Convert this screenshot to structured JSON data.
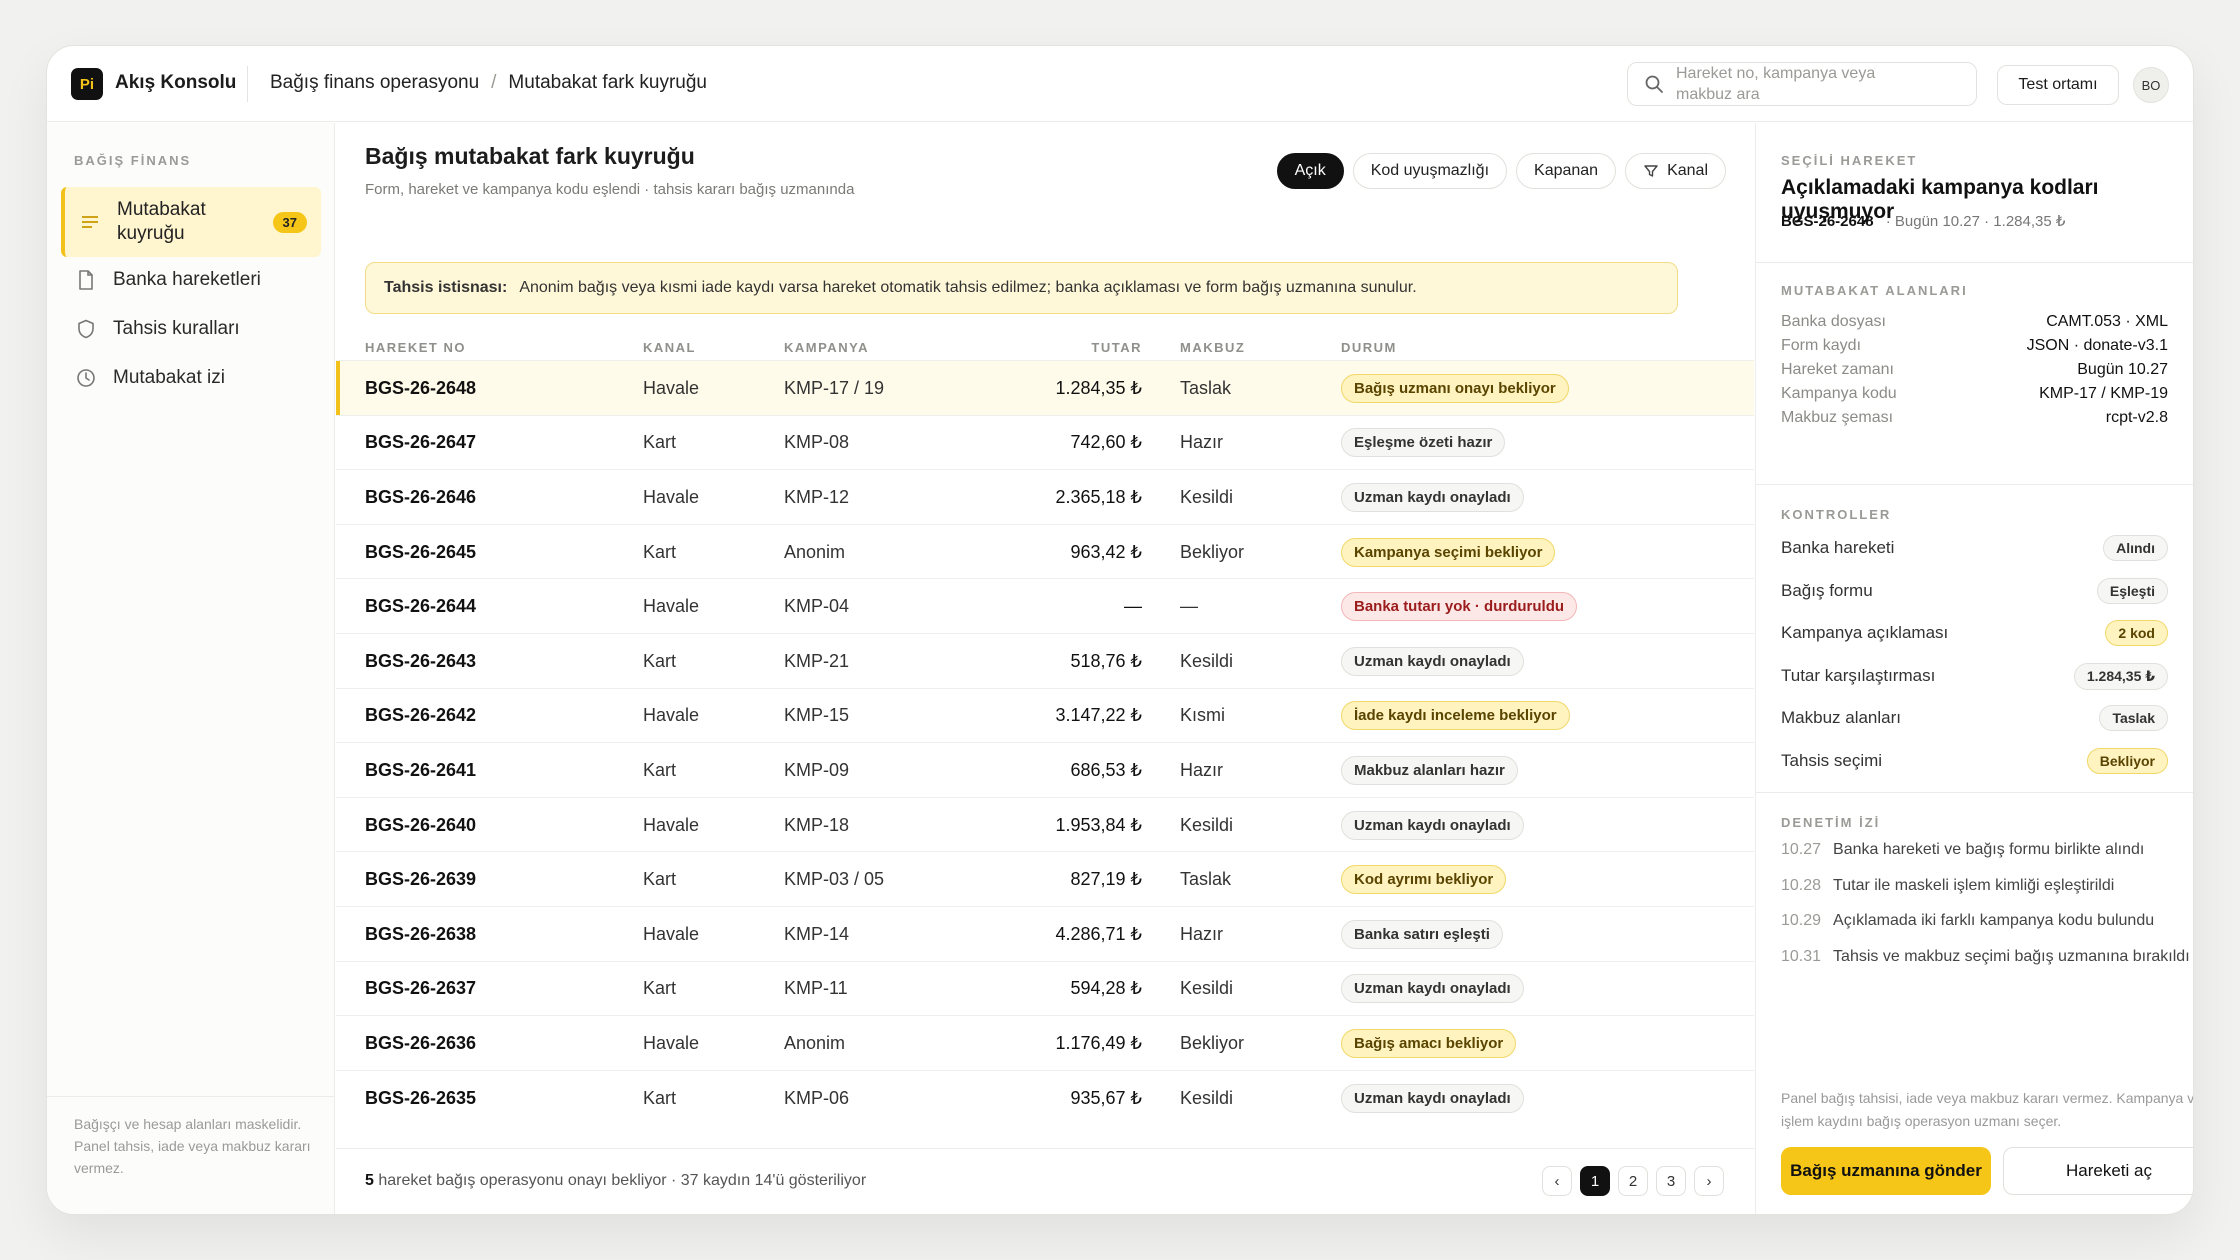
{
  "app": {
    "logo": "Pi",
    "title": "Akış Konsolu"
  },
  "breadcrumb": [
    "Bağış finans operasyonu",
    "Mutabakat fark kuyruğu"
  ],
  "search": {
    "placeholder": "Hareket no, kampanya veya makbuz ara"
  },
  "header": {
    "env_label": "Test ortamı",
    "avatar": "BO"
  },
  "sidebar": {
    "heading": "BAĞIŞ FİNANS",
    "items": [
      {
        "label": "Mutabakat kuyruğu",
        "icon": "list-icon",
        "count": "37"
      },
      {
        "label": "Banka hareketleri",
        "icon": "document-icon"
      },
      {
        "label": "Tahsis kuralları",
        "icon": "shield-icon"
      },
      {
        "label": "Mutabakat izi",
        "icon": "clock-icon"
      }
    ],
    "footer": "Bağışçı ve hesap alanları maskelidir. Panel tahsis, iade veya makbuz kararı vermez."
  },
  "main": {
    "title": "Bağış mutabakat fark kuyruğu",
    "subtitle": "Form, hareket ve kampanya kodu eşlendi · tahsis kararı bağış uzmanında",
    "filters": [
      "Açık",
      "Kod uyuşmazlığı",
      "Kapanan",
      "Kanal"
    ],
    "notice": {
      "label": "Tahsis istisnası:",
      "text": "Anonim bağış veya kısmi iade kaydı varsa hareket otomatik tahsis edilmez; banka açıklaması ve form bağış uzmanına sunulur."
    },
    "columns": [
      "HAREKET NO",
      "KANAL",
      "KAMPANYA",
      "TUTAR",
      "MAKBUZ",
      "DURUM"
    ],
    "rows": [
      {
        "no": "BGS-26-2648",
        "kanal": "Havale",
        "kampanya": "KMP-17 / 19",
        "tutar": "1.284,35 ₺",
        "makbuz": "Taslak",
        "durum": "Bağış uzmanı onayı bekliyor",
        "status": "warn"
      },
      {
        "no": "BGS-26-2647",
        "kanal": "Kart",
        "kampanya": "KMP-08",
        "tutar": "742,60 ₺",
        "makbuz": "Hazır",
        "durum": "Eşleşme özeti hazır",
        "status": "neutral"
      },
      {
        "no": "BGS-26-2646",
        "kanal": "Havale",
        "kampanya": "KMP-12",
        "tutar": "2.365,18 ₺",
        "makbuz": "Kesildi",
        "durum": "Uzman kaydı onayladı",
        "status": "neutral"
      },
      {
        "no": "BGS-26-2645",
        "kanal": "Kart",
        "kampanya": "Anonim",
        "tutar": "963,42 ₺",
        "makbuz": "Bekliyor",
        "durum": "Kampanya seçimi bekliyor",
        "status": "warn"
      },
      {
        "no": "BGS-26-2644",
        "kanal": "Havale",
        "kampanya": "KMP-04",
        "tutar": "—",
        "makbuz": "—",
        "durum": "Banka tutarı yok · durduruldu",
        "status": "err"
      },
      {
        "no": "BGS-26-2643",
        "kanal": "Kart",
        "kampanya": "KMP-21",
        "tutar": "518,76 ₺",
        "makbuz": "Kesildi",
        "durum": "Uzman kaydı onayladı",
        "status": "neutral"
      },
      {
        "no": "BGS-26-2642",
        "kanal": "Havale",
        "kampanya": "KMP-15",
        "tutar": "3.147,22 ₺",
        "makbuz": "Kısmi",
        "durum": "İade kaydı inceleme bekliyor",
        "status": "warn"
      },
      {
        "no": "BGS-26-2641",
        "kanal": "Kart",
        "kampanya": "KMP-09",
        "tutar": "686,53 ₺",
        "makbuz": "Hazır",
        "durum": "Makbuz alanları hazır",
        "status": "neutral"
      },
      {
        "no": "BGS-26-2640",
        "kanal": "Havale",
        "kampanya": "KMP-18",
        "tutar": "1.953,84 ₺",
        "makbuz": "Kesildi",
        "durum": "Uzman kaydı onayladı",
        "status": "neutral"
      },
      {
        "no": "BGS-26-2639",
        "kanal": "Kart",
        "kampanya": "KMP-03 / 05",
        "tutar": "827,19 ₺",
        "makbuz": "Taslak",
        "durum": "Kod ayrımı bekliyor",
        "status": "warn"
      },
      {
        "no": "BGS-26-2638",
        "kanal": "Havale",
        "kampanya": "KMP-14",
        "tutar": "4.286,71 ₺",
        "makbuz": "Hazır",
        "durum": "Banka satırı eşleşti",
        "status": "neutral"
      },
      {
        "no": "BGS-26-2637",
        "kanal": "Kart",
        "kampanya": "KMP-11",
        "tutar": "594,28 ₺",
        "makbuz": "Kesildi",
        "durum": "Uzman kaydı onayladı",
        "status": "neutral"
      },
      {
        "no": "BGS-26-2636",
        "kanal": "Havale",
        "kampanya": "Anonim",
        "tutar": "1.176,49 ₺",
        "makbuz": "Bekliyor",
        "durum": "Bağış amacı bekliyor",
        "status": "warn"
      },
      {
        "no": "BGS-26-2635",
        "kanal": "Kart",
        "kampanya": "KMP-06",
        "tutar": "935,67 ₺",
        "makbuz": "Kesildi",
        "durum": "Uzman kaydı onayladı",
        "status": "neutral"
      }
    ],
    "footer": {
      "count": "5",
      "text": "hareket bağış operasyonu onayı bekliyor · 37 kaydın 14'ü gösteriliyor"
    },
    "pager": [
      "‹",
      "1",
      "2",
      "3",
      "›"
    ]
  },
  "panel": {
    "heading": "SEÇİLİ HAREKET",
    "title": "Açıklamadaki kampanya kodları uyuşmuyor",
    "meta_id": "BGS-26-2648",
    "meta_text": "· Bugün 10.27 · 1.284,35 ₺",
    "fields_heading": "MUTABAKAT ALANLARI",
    "fields": [
      {
        "k": "Banka dosyası",
        "v": "CAMT.053 · XML"
      },
      {
        "k": "Form kaydı",
        "v": "JSON · donate-v3.1"
      },
      {
        "k": "Hareket zamanı",
        "v": "Bugün 10.27"
      },
      {
        "k": "Kampanya kodu",
        "v": "KMP-17 / KMP-19"
      },
      {
        "k": "Makbuz şeması",
        "v": "rcpt-v2.8"
      }
    ],
    "checks_heading": "KONTROLLER",
    "checks": [
      {
        "k": "Banka hareketi",
        "v": "Alındı",
        "status": "neutral"
      },
      {
        "k": "Bağış formu",
        "v": "Eşleşti",
        "status": "neutral"
      },
      {
        "k": "Kampanya açıklaması",
        "v": "2 kod",
        "status": "warn"
      },
      {
        "k": "Tutar karşılaştırması",
        "v": "1.284,35 ₺",
        "status": "neutral"
      },
      {
        "k": "Makbuz alanları",
        "v": "Taslak",
        "status": "neutral"
      },
      {
        "k": "Tahsis seçimi",
        "v": "Bekliyor",
        "status": "warn"
      }
    ],
    "audit_heading": "DENETİM İZİ",
    "audit": [
      {
        "t": "10.27",
        "text": "Banka hareketi ve bağış formu birlikte alındı"
      },
      {
        "t": "10.28",
        "text": "Tutar ile maskeli işlem kimliği eşleştirildi"
      },
      {
        "t": "10.29",
        "text": "Açıklamada iki farklı kampanya kodu bulundu"
      },
      {
        "t": "10.31",
        "text": "Tahsis ve makbuz seçimi bağış uzmanına bırakıldı"
      }
    ],
    "note": "Panel bağış tahsisi, iade veya makbuz kararı vermez. Kampanya ve işlem kaydını bağış operasyon uzmanı seçer.",
    "primary_button": "Bağış uzmanına gönder",
    "secondary_button": "Hareketi aç"
  },
  "colors": {
    "accent": "#f5c518",
    "warn_bg": "#fff3bf",
    "error_bg": "#fde8e8"
  }
}
